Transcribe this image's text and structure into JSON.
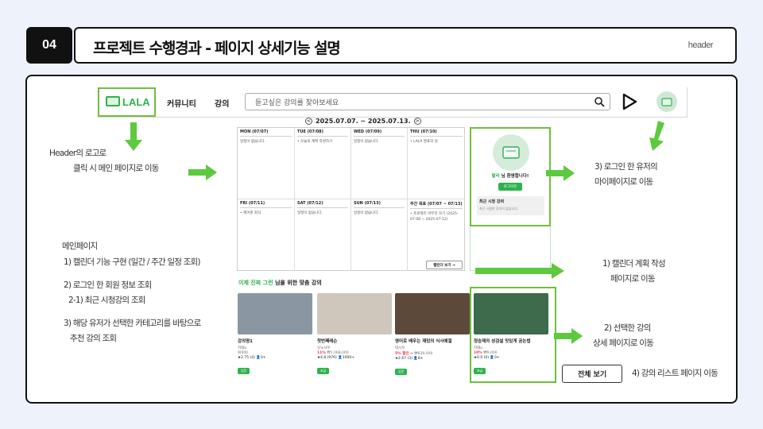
{
  "slide": {
    "number": "04",
    "title": "프로젝트 수행경과 - 페이지 상세기능 설명",
    "section_label": "header"
  },
  "site": {
    "logo_text": "LALA",
    "nav": [
      "커뮤니티",
      "강의"
    ],
    "search_placeholder": "듣고싶은 강의를 찾아보세요"
  },
  "calendar": {
    "range": "2025.07.07. ~ 2025.07.13.",
    "prev": "<",
    "next": ">",
    "days": [
      {
        "label": "MON (07/07)",
        "events": [
          "일정이 없습니다."
        ]
      },
      {
        "label": "TUE (07/08)",
        "events": [
          "• 오늘의 계획 작성하기"
        ]
      },
      {
        "label": "WED (07/09)",
        "events": [
          "일정이 없습니다."
        ]
      },
      {
        "label": "THU (07/10)",
        "events": [
          "• LALA 발표의 날"
        ]
      },
      {
        "label": "FRI (07/11)",
        "events": [
          "• 헤어준 회식"
        ]
      },
      {
        "label": "SAT (07/12)",
        "events": [
          "일정이 없습니다."
        ]
      },
      {
        "label": "SUN (07/13)",
        "events": [
          "일정이 없습니다."
        ]
      },
      {
        "label": "주간 목표 (07/07 ~ 07/13)",
        "events": [
          "• 프로젝트 마무리 하기 (2025-07-06 ~ 2025-07-12)"
        ]
      }
    ],
    "button": "캘린더 보기 →"
  },
  "profile": {
    "name": "랄라",
    "greeting": " 님 환영합니다!",
    "logout": "로그아웃",
    "recent_title": "최근 시청 강의",
    "recent_empty": "최근 시청한 강의가 없습니다."
  },
  "recommend": {
    "title_green": "이제 진짜 그런",
    "title_rest": " 님을 위한 맞춤 강의",
    "cards": [
      {
        "title": "강의명1",
        "sub": "지태u",
        "price": "W000",
        "rating": "★2.75 (4) 👤0+",
        "disc": "",
        "tag": "입문",
        "thumb": "#7e8c98"
      },
      {
        "title": "첫번째레슨",
        "sub": "오노사우",
        "price": "₩1,068,000",
        "rating": "★4.8 (976) 👤1000+",
        "disc": "11%",
        "tag": "초급",
        "thumb": "#c9c2b7"
      },
      {
        "title": "영어로 배우는 재밌의 식사예절",
        "sub": "박시우",
        "price": "₩830,000",
        "rating": "★2.67 (3) 👤8+",
        "disc": "5% 할인 →",
        "tag": "입문",
        "thumb": "#5d4a3b"
      },
      {
        "title": "정승제의 성검설 맛있게 공논법",
        "sub": "지태u",
        "price": "₩9,000",
        "rating": "★0.0 (0) 👤0+",
        "disc": "10%",
        "tag": "초급",
        "thumb": "#3f6a4a"
      }
    ],
    "all_button": "전체 보기"
  },
  "notes": {
    "header_logo": [
      "Header의 로고로",
      "클릭 시 메인 페이지로 이동"
    ],
    "main_page": [
      "메인페이지",
      "1) 캘린더 기능 구현 (일간 / 주간 일정 조회)",
      "2) 로그인 한 회원 정보 조회",
      "2-1) 최근 시청강의 조회",
      "3) 해당 유저가 선택한 카테고리를 바탕으로",
      "추천 강의 조회"
    ],
    "mypage": [
      "3) 로그인 한 유저의",
      "마이페이지로 이동"
    ],
    "calendar_plan": [
      "1) 캘린더 계획 작성",
      "페이지로 이동"
    ],
    "lecture_detail": [
      "2) 선택한 강의",
      "상세 페이지로 이동"
    ],
    "lecture_list": "4) 강의 리스트 페이지 이동"
  },
  "colors": {
    "accent": "#2fb24c",
    "arrow": "#5dc93f",
    "frame": "#6fbf3a"
  }
}
